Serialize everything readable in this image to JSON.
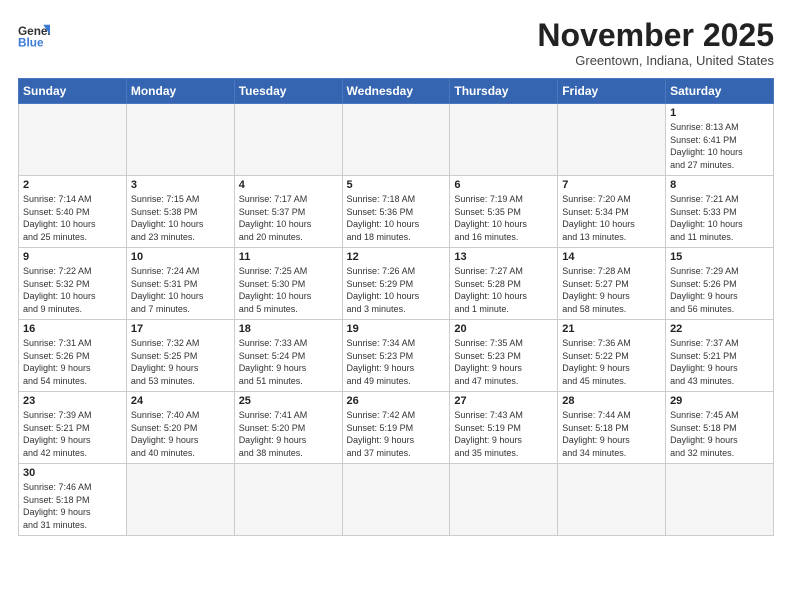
{
  "header": {
    "logo_general": "General",
    "logo_blue": "Blue",
    "month_title": "November 2025",
    "subtitle": "Greentown, Indiana, United States"
  },
  "weekdays": [
    "Sunday",
    "Monday",
    "Tuesday",
    "Wednesday",
    "Thursday",
    "Friday",
    "Saturday"
  ],
  "weeks": [
    [
      {
        "day": "",
        "info": ""
      },
      {
        "day": "",
        "info": ""
      },
      {
        "day": "",
        "info": ""
      },
      {
        "day": "",
        "info": ""
      },
      {
        "day": "",
        "info": ""
      },
      {
        "day": "",
        "info": ""
      },
      {
        "day": "1",
        "info": "Sunrise: 8:13 AM\nSunset: 6:41 PM\nDaylight: 10 hours\nand 27 minutes."
      }
    ],
    [
      {
        "day": "2",
        "info": "Sunrise: 7:14 AM\nSunset: 5:40 PM\nDaylight: 10 hours\nand 25 minutes."
      },
      {
        "day": "3",
        "info": "Sunrise: 7:15 AM\nSunset: 5:38 PM\nDaylight: 10 hours\nand 23 minutes."
      },
      {
        "day": "4",
        "info": "Sunrise: 7:17 AM\nSunset: 5:37 PM\nDaylight: 10 hours\nand 20 minutes."
      },
      {
        "day": "5",
        "info": "Sunrise: 7:18 AM\nSunset: 5:36 PM\nDaylight: 10 hours\nand 18 minutes."
      },
      {
        "day": "6",
        "info": "Sunrise: 7:19 AM\nSunset: 5:35 PM\nDaylight: 10 hours\nand 16 minutes."
      },
      {
        "day": "7",
        "info": "Sunrise: 7:20 AM\nSunset: 5:34 PM\nDaylight: 10 hours\nand 13 minutes."
      },
      {
        "day": "8",
        "info": "Sunrise: 7:21 AM\nSunset: 5:33 PM\nDaylight: 10 hours\nand 11 minutes."
      }
    ],
    [
      {
        "day": "9",
        "info": "Sunrise: 7:22 AM\nSunset: 5:32 PM\nDaylight: 10 hours\nand 9 minutes."
      },
      {
        "day": "10",
        "info": "Sunrise: 7:24 AM\nSunset: 5:31 PM\nDaylight: 10 hours\nand 7 minutes."
      },
      {
        "day": "11",
        "info": "Sunrise: 7:25 AM\nSunset: 5:30 PM\nDaylight: 10 hours\nand 5 minutes."
      },
      {
        "day": "12",
        "info": "Sunrise: 7:26 AM\nSunset: 5:29 PM\nDaylight: 10 hours\nand 3 minutes."
      },
      {
        "day": "13",
        "info": "Sunrise: 7:27 AM\nSunset: 5:28 PM\nDaylight: 10 hours\nand 1 minute."
      },
      {
        "day": "14",
        "info": "Sunrise: 7:28 AM\nSunset: 5:27 PM\nDaylight: 9 hours\nand 58 minutes."
      },
      {
        "day": "15",
        "info": "Sunrise: 7:29 AM\nSunset: 5:26 PM\nDaylight: 9 hours\nand 56 minutes."
      }
    ],
    [
      {
        "day": "16",
        "info": "Sunrise: 7:31 AM\nSunset: 5:26 PM\nDaylight: 9 hours\nand 54 minutes."
      },
      {
        "day": "17",
        "info": "Sunrise: 7:32 AM\nSunset: 5:25 PM\nDaylight: 9 hours\nand 53 minutes."
      },
      {
        "day": "18",
        "info": "Sunrise: 7:33 AM\nSunset: 5:24 PM\nDaylight: 9 hours\nand 51 minutes."
      },
      {
        "day": "19",
        "info": "Sunrise: 7:34 AM\nSunset: 5:23 PM\nDaylight: 9 hours\nand 49 minutes."
      },
      {
        "day": "20",
        "info": "Sunrise: 7:35 AM\nSunset: 5:23 PM\nDaylight: 9 hours\nand 47 minutes."
      },
      {
        "day": "21",
        "info": "Sunrise: 7:36 AM\nSunset: 5:22 PM\nDaylight: 9 hours\nand 45 minutes."
      },
      {
        "day": "22",
        "info": "Sunrise: 7:37 AM\nSunset: 5:21 PM\nDaylight: 9 hours\nand 43 minutes."
      }
    ],
    [
      {
        "day": "23",
        "info": "Sunrise: 7:39 AM\nSunset: 5:21 PM\nDaylight: 9 hours\nand 42 minutes."
      },
      {
        "day": "24",
        "info": "Sunrise: 7:40 AM\nSunset: 5:20 PM\nDaylight: 9 hours\nand 40 minutes."
      },
      {
        "day": "25",
        "info": "Sunrise: 7:41 AM\nSunset: 5:20 PM\nDaylight: 9 hours\nand 38 minutes."
      },
      {
        "day": "26",
        "info": "Sunrise: 7:42 AM\nSunset: 5:19 PM\nDaylight: 9 hours\nand 37 minutes."
      },
      {
        "day": "27",
        "info": "Sunrise: 7:43 AM\nSunset: 5:19 PM\nDaylight: 9 hours\nand 35 minutes."
      },
      {
        "day": "28",
        "info": "Sunrise: 7:44 AM\nSunset: 5:18 PM\nDaylight: 9 hours\nand 34 minutes."
      },
      {
        "day": "29",
        "info": "Sunrise: 7:45 AM\nSunset: 5:18 PM\nDaylight: 9 hours\nand 32 minutes."
      }
    ],
    [
      {
        "day": "30",
        "info": "Sunrise: 7:46 AM\nSunset: 5:18 PM\nDaylight: 9 hours\nand 31 minutes."
      },
      {
        "day": "",
        "info": ""
      },
      {
        "day": "",
        "info": ""
      },
      {
        "day": "",
        "info": ""
      },
      {
        "day": "",
        "info": ""
      },
      {
        "day": "",
        "info": ""
      },
      {
        "day": "",
        "info": ""
      }
    ]
  ]
}
